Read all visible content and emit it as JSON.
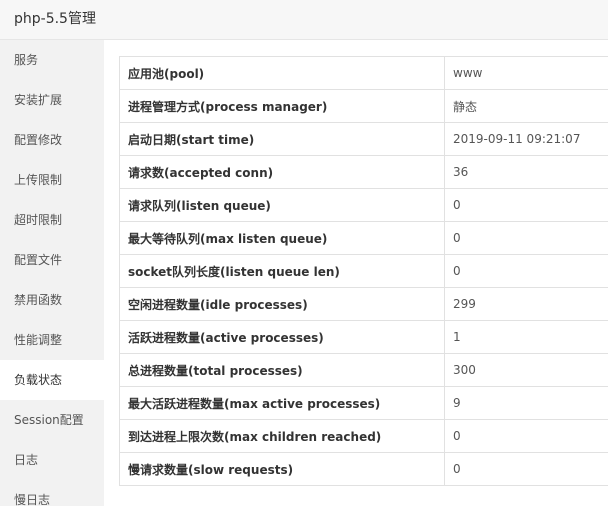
{
  "window": {
    "title": "php-5.5管理"
  },
  "sidebar": {
    "active_index": 9,
    "items": [
      {
        "label": "服务"
      },
      {
        "label": "安装扩展"
      },
      {
        "label": "配置修改"
      },
      {
        "label": "上传限制"
      },
      {
        "label": "超时限制"
      },
      {
        "label": "配置文件"
      },
      {
        "label": "禁用函数"
      },
      {
        "label": "性能调整"
      },
      {
        "label": "负载状态"
      },
      {
        "label": "Session配置"
      },
      {
        "label": "日志"
      },
      {
        "label": "慢日志"
      }
    ]
  },
  "status": {
    "rows": [
      {
        "key": "应用池(pool)",
        "value": "www"
      },
      {
        "key": "进程管理方式(process manager)",
        "value": "静态"
      },
      {
        "key": "启动日期(start time)",
        "value": "2019-09-11 09:21:07"
      },
      {
        "key": "请求数(accepted conn)",
        "value": "36"
      },
      {
        "key": "请求队列(listen queue)",
        "value": "0"
      },
      {
        "key": "最大等待队列(max listen queue)",
        "value": "0"
      },
      {
        "key": "socket队列长度(listen queue len)",
        "value": "0"
      },
      {
        "key": "空闲进程数量(idle processes)",
        "value": "299"
      },
      {
        "key": "活跃进程数量(active processes)",
        "value": "1"
      },
      {
        "key": "总进程数量(total processes)",
        "value": "300"
      },
      {
        "key": "最大活跃进程数量(max active processes)",
        "value": "9"
      },
      {
        "key": "到达进程上限次数(max children reached)",
        "value": "0"
      },
      {
        "key": "慢请求数量(slow requests)",
        "value": "0"
      }
    ]
  }
}
